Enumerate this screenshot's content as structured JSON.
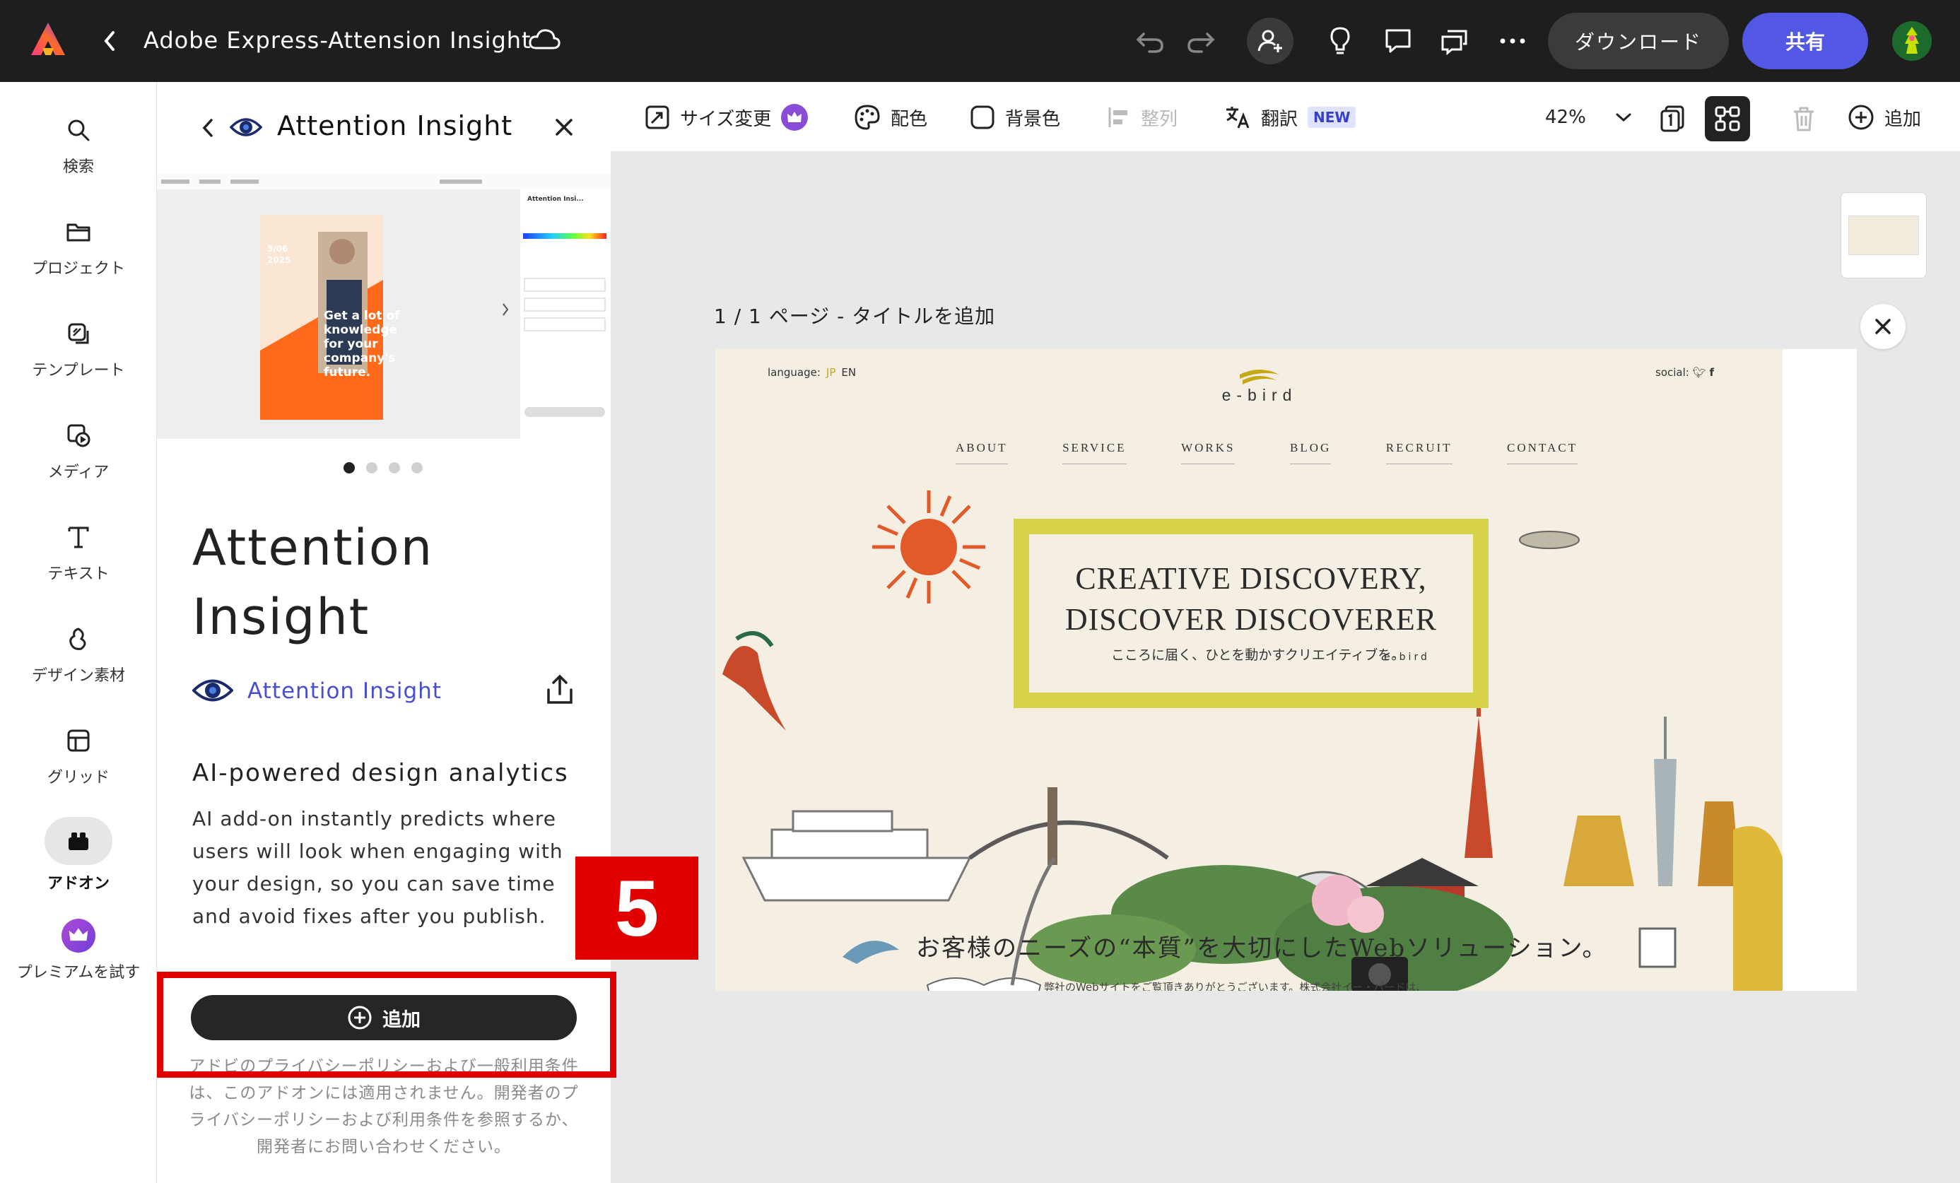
{
  "topbar": {
    "doc_title": "Adobe Express-Attension Insight",
    "download_label": "ダウンロード",
    "share_label": "共有",
    "icons": [
      "adobe-express-logo",
      "back-chevron-icon",
      "cloud-icon",
      "undo-icon",
      "redo-icon",
      "add-user-icon",
      "lightbulb-icon",
      "comment-icon",
      "present-icon",
      "more-icon",
      "avatar"
    ]
  },
  "rail": {
    "items": [
      {
        "label": "検索",
        "icon": "search-icon"
      },
      {
        "label": "プロジェクト",
        "icon": "folder-icon"
      },
      {
        "label": "テンプレート",
        "icon": "template-icon"
      },
      {
        "label": "メディア",
        "icon": "media-icon"
      },
      {
        "label": "テキスト",
        "icon": "text-icon"
      },
      {
        "label": "デザイン素材",
        "icon": "shapes-icon"
      },
      {
        "label": "グリッド",
        "icon": "grid-icon"
      },
      {
        "label": "アドオン",
        "icon": "addon-icon",
        "active": true
      },
      {
        "label": "プレミアムを試す",
        "icon": "crown-icon"
      }
    ]
  },
  "panel": {
    "header_title": "Attention Insight",
    "big_title": "Attention Insight",
    "publisher": "Attention Insight",
    "tagline": "AI-powered design analytics",
    "description": "AI add-on instantly predicts where users will look when engaging with your design, so you can save time and avoid fixes after you publish.",
    "add_button": "追加",
    "legal": "アドビのプライバシーポリシーおよび一般利用条件は、このアドオンには適用されません。開発者のプライバシーポリシーおよび利用条件を参照するか、開発者にお問い合わせください。",
    "carousel": {
      "count": 4,
      "active": 0
    },
    "step_number": "5",
    "preview": {
      "poster_lines": [
        "Get a lot of",
        "knowledge",
        "for your",
        "company's",
        "future."
      ],
      "poster_date": "5/06\n2025",
      "side_title": "Attention Insi..."
    }
  },
  "toolbar2": {
    "resize": "サイズ変更",
    "color": "配色",
    "background": "背景色",
    "align": "整列",
    "translate": "翻訳",
    "new_badge": "NEW",
    "zoom": "42%",
    "add": "追加"
  },
  "canvas": {
    "page_label": "1 / 1 ページ - タイトルを追加"
  },
  "site": {
    "language_label": "language:",
    "lang_jp": "JP",
    "lang_en": "EN",
    "social_label": "social:",
    "logo_text": "e-bird",
    "nav": [
      "ABOUT",
      "SERVICE",
      "WORKS",
      "BLOG",
      "RECRUIT",
      "CONTACT"
    ],
    "hero_line1": "CREATIVE DISCOVERY,",
    "hero_line2": "DISCOVER DISCOVERER",
    "hero_sub": "こころに届く、ひとを動かすクリエイティブを。",
    "hero_sub_logo": "e-bird",
    "tagline": "お客様のニーズの“本質”を大切にしたWebソリューション。",
    "small_text": "弊社のWebサイトをご覧頂きありがとうございます。株式会社イー・バードは、",
    "colors": {
      "accent": "#d6d34a",
      "paper": "#f4efe2"
    }
  },
  "colors": {
    "topbar": "#1e1e1e",
    "share": "#5258e4",
    "highlight": "#e10000",
    "publisher_link": "#4a4fd0"
  }
}
